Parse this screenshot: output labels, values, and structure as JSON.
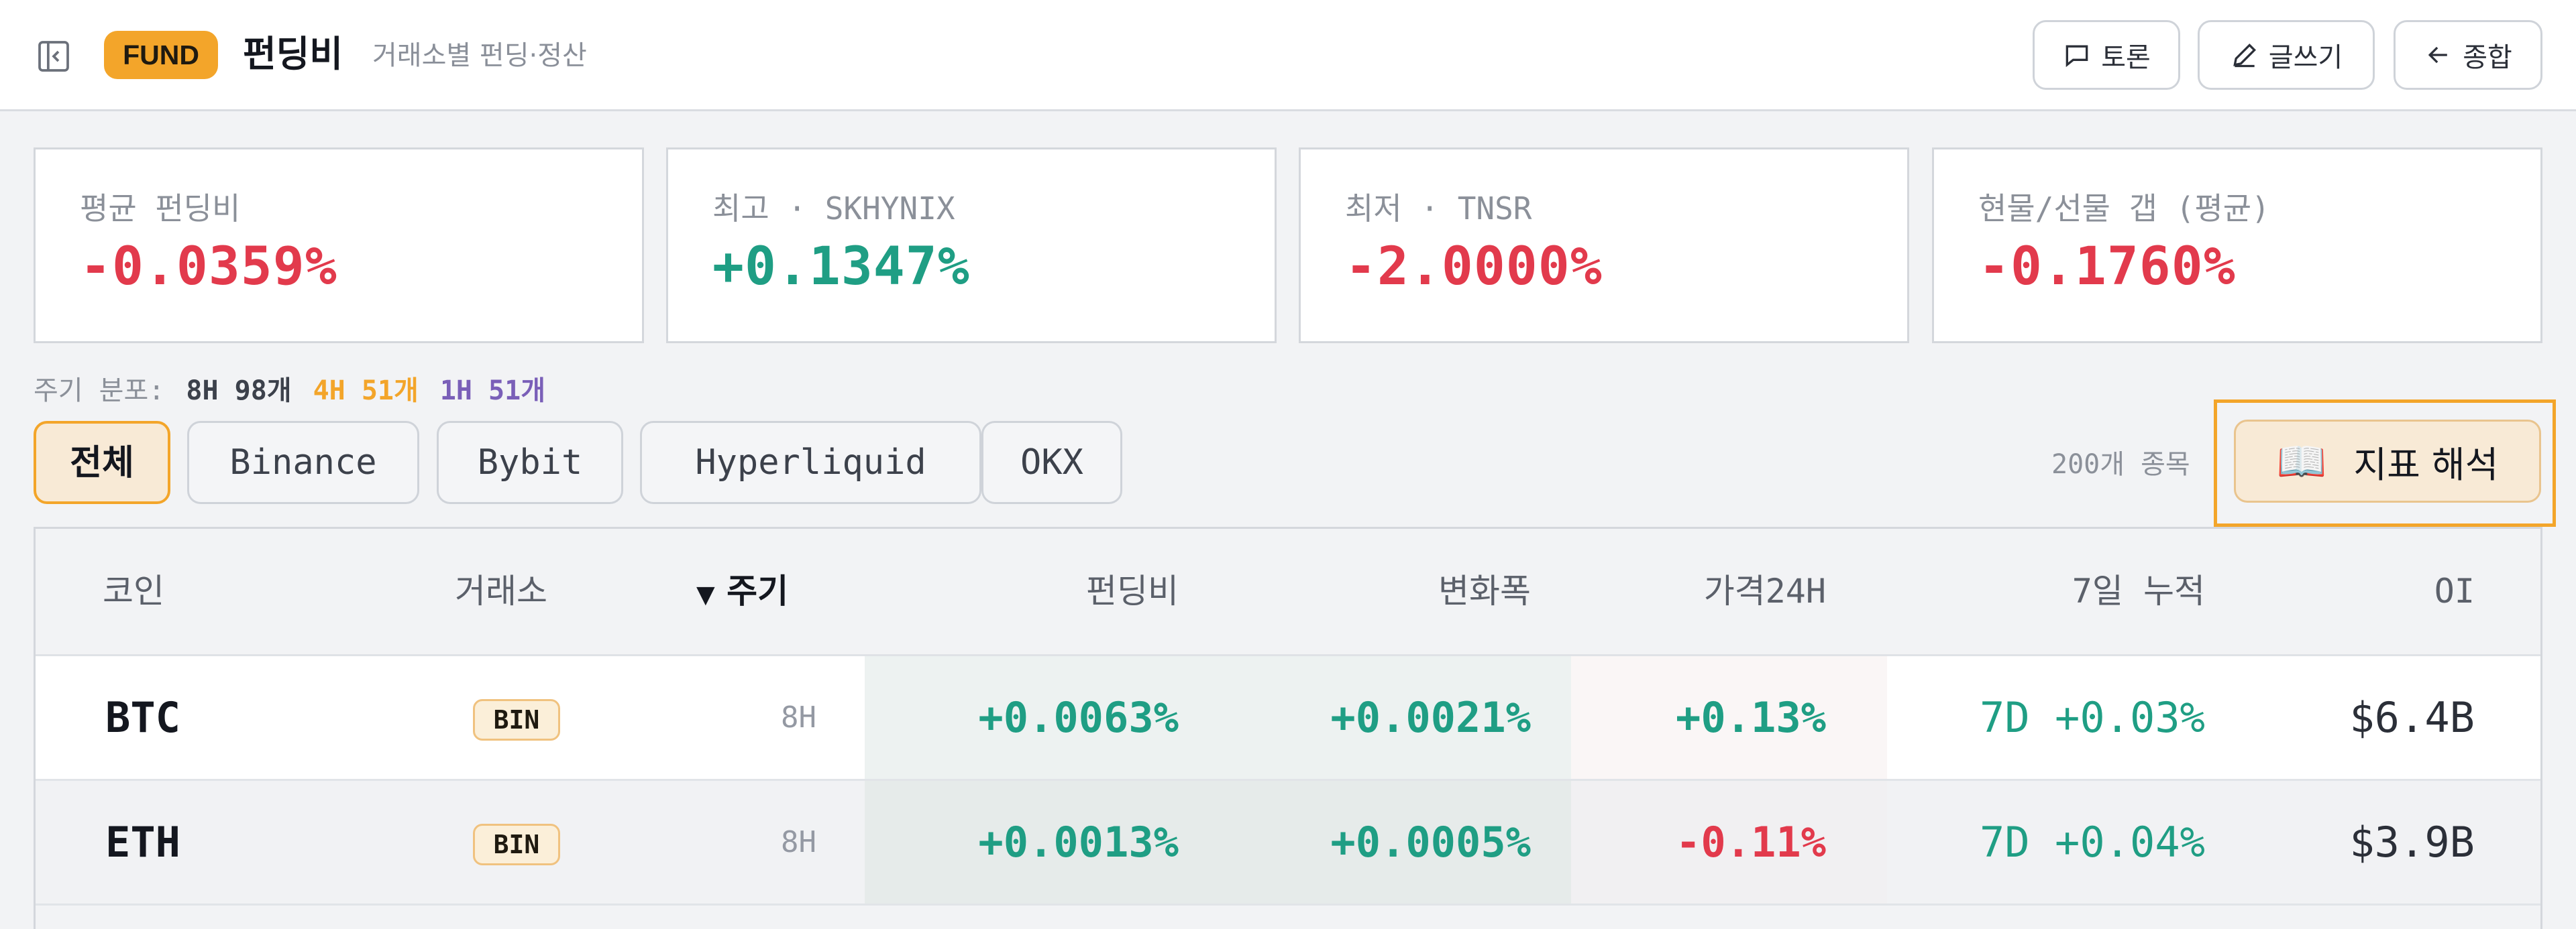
{
  "header": {
    "badge": "FUND",
    "title": "펀딩비",
    "subtitle": "거래소별 펀딩·정산",
    "buttons": {
      "discuss": "토론",
      "write": "글쓰기",
      "overview": "종합"
    }
  },
  "kpis": [
    {
      "label": "평균 펀딩비",
      "value": "-0.0359%",
      "tone": "negative"
    },
    {
      "label": "최고 · SKHYNIX",
      "value": "+0.1347%",
      "tone": "positive"
    },
    {
      "label": "최저 · TNSR",
      "value": "-2.0000%",
      "tone": "negative"
    },
    {
      "label": "현물/선물 갭 (평균)",
      "value": "-0.1760%",
      "tone": "negative"
    }
  ],
  "cycle_distribution": {
    "label": "주기 분포:",
    "items": [
      "8H 98개",
      "4H 51개",
      "1H 51개"
    ]
  },
  "tabs": [
    "전체",
    "Binance",
    "Bybit",
    "Hyperliquid",
    "OKX"
  ],
  "active_tab": "전체",
  "item_count": "200개 종목",
  "guide_button": "지표 해석",
  "table": {
    "headers": {
      "coin": "코인",
      "exchange": "거래소",
      "cycle": "주기",
      "rate": "펀딩비",
      "change": "변화폭",
      "price24h": "가격24H",
      "cum7d": "7일 누적",
      "oi": "OI"
    },
    "sort_indicator": "▼",
    "rows": [
      {
        "coin": "BTC",
        "exchange": "BIN",
        "cycle": "8H",
        "rate": "+0.0063%",
        "change": "+0.0021%",
        "price24h": "+0.13%",
        "cum7d": "7D +0.03%",
        "oi": "$6.4B"
      },
      {
        "coin": "ETH",
        "exchange": "BIN",
        "cycle": "8H",
        "rate": "+0.0013%",
        "change": "+0.0005%",
        "price24h": "-0.11%",
        "cum7d": "7D +0.04%",
        "oi": "$3.9B"
      }
    ]
  },
  "colors": {
    "accent": "#f3a52a",
    "positive": "#1f9e84",
    "negative": "#e23a4c",
    "cycle_4h": "#f3a52a",
    "cycle_1h": "#7a5fb8"
  },
  "icons": {
    "collapse": "sidebar-collapse-icon",
    "discuss": "chat-bubble-icon",
    "write": "pencil-icon",
    "overview": "arrow-left-icon",
    "guide": "open-book-icon"
  }
}
